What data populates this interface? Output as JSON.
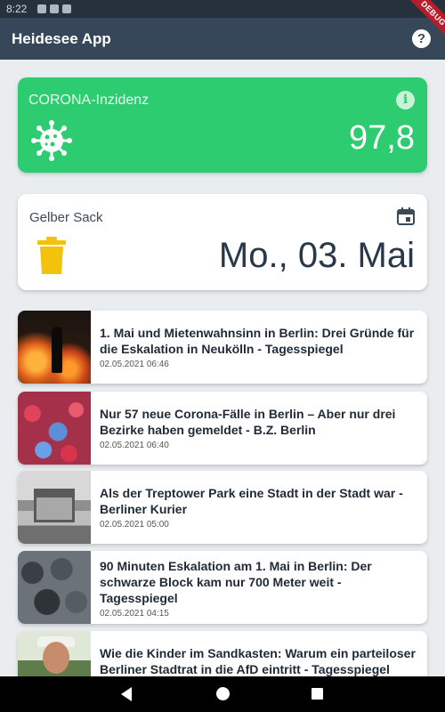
{
  "status_bar": {
    "time": "8:22"
  },
  "app_bar": {
    "title": "Heidesee App",
    "help_icon_glyph": "?"
  },
  "debug_banner": {
    "label": "DEBUG"
  },
  "corona_card": {
    "label": "CORONA-Inzidenz",
    "value": "97,8",
    "info_icon_glyph": "i",
    "color": "#2ecc71"
  },
  "trash_card": {
    "label": "Gelber Sack",
    "date": "Mo., 03. Mai",
    "bin_color": "#f4c20d"
  },
  "news": [
    {
      "headline": "1. Mai und Mietenwahnsinn in Berlin: Drei Gründe für die Eskalation in Neukölln - Tagesspiegel",
      "time": "02.05.2021 06:46",
      "icon": "protest-fire-photo"
    },
    {
      "headline": "Nur 57 neue Corona-Fälle in Berlin – Aber nur drei Bezirke haben gemeldet - B.Z. Berlin",
      "time": "02.05.2021 06:40",
      "icon": "virus-particles-photo"
    },
    {
      "headline": "Als der Treptower Park eine Stadt in der Stadt war - Berliner Kurier",
      "time": "02.05.2021 05:00",
      "icon": "historic-building-photo"
    },
    {
      "headline": "90 Minuten Eskalation am 1. Mai in Berlin: Der schwarze Block kam nur 700 Meter weit - Tagesspiegel",
      "time": "02.05.2021 04:15",
      "icon": "crowd-photo"
    },
    {
      "headline": "Wie die Kinder im Sandkasten: Warum ein parteiloser Berliner Stadtrat in die AfD eintritt - Tagesspiegel",
      "time": "",
      "icon": "portrait-photo"
    }
  ]
}
